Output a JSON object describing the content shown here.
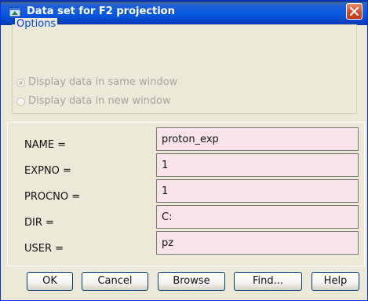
{
  "window": {
    "title": "Data set for F2 projection",
    "icons": [
      "app-icon",
      "close-icon"
    ]
  },
  "options": {
    "group_title": "Options",
    "radios": [
      {
        "label": "Display data in same window",
        "selected": true,
        "enabled": false
      },
      {
        "label": "Display data in new window",
        "selected": false,
        "enabled": false
      }
    ]
  },
  "fields": [
    {
      "label": "NAME =",
      "value": "proton_exp"
    },
    {
      "label": "EXPNO =",
      "value": "1"
    },
    {
      "label": "PROCNO =",
      "value": "1"
    },
    {
      "label": "DIR =",
      "value": "C:"
    },
    {
      "label": "USER =",
      "value": "pz"
    }
  ],
  "buttons": {
    "ok": "OK",
    "cancel": "Cancel",
    "browse": "Browse",
    "find": "Find...",
    "help": "Help"
  },
  "colors": {
    "titlebar": "#0a5ae1",
    "group_title": "#0046d5",
    "input_bg": "#f8e4e8",
    "close_button": "#d44a27"
  }
}
